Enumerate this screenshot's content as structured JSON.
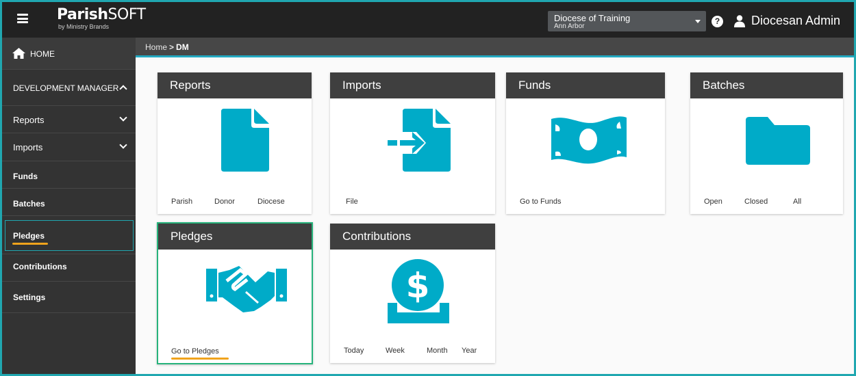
{
  "topbar": {
    "logo_parish": "Parish",
    "logo_soft": "SOFT",
    "logo_sub": "by Ministry Brands",
    "diocese_name": "Diocese of Training",
    "diocese_sub": "Ann Arbor",
    "help_glyph": "?",
    "user_name": "Diocesan Admin"
  },
  "sidebar": {
    "home": "HOME",
    "section": "DEVELOPMENT MANAGER",
    "items": {
      "reports": "Reports",
      "imports": "Imports",
      "funds": "Funds",
      "batches": "Batches",
      "pledges": "Pledges",
      "contributions": "Contributions",
      "settings": "Settings"
    }
  },
  "breadcrumb": {
    "home": "Home",
    "separator": ">",
    "current": "DM"
  },
  "cards": {
    "reports": {
      "title": "Reports",
      "links": [
        "Parish",
        "Donor",
        "Diocese"
      ]
    },
    "imports": {
      "title": "Imports",
      "links": [
        "File"
      ]
    },
    "funds": {
      "title": "Funds",
      "links": [
        "Go to Funds"
      ]
    },
    "batches": {
      "title": "Batches",
      "links": [
        "Open",
        "Closed",
        "All"
      ]
    },
    "pledges": {
      "title": "Pledges",
      "links": [
        "Go to Pledges"
      ]
    },
    "contributions": {
      "title": "Contributions",
      "links": [
        "Today",
        "Week",
        "Month",
        "Year"
      ]
    }
  },
  "colors": {
    "accent": "#00abc8",
    "topbar": "#222222",
    "sidebar": "#333333",
    "card_header": "#3f3f3f",
    "highlight_underline": "#f0a31c",
    "selected_border": "#26b37b"
  }
}
